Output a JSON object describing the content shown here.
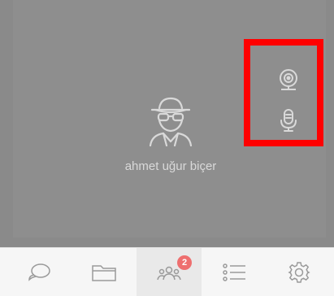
{
  "participant": {
    "name": "ahmet uğur biçer",
    "avatar_icon": "incognito-user-icon"
  },
  "media_controls": {
    "camera_icon": "webcam-icon",
    "mic_icon": "microphone-icon",
    "highlight_color": "#ff0000"
  },
  "toolbar": {
    "items": [
      {
        "icon": "chat-icon"
      },
      {
        "icon": "folder-icon"
      },
      {
        "icon": "participants-icon",
        "badge": "2",
        "active": true
      },
      {
        "icon": "list-icon"
      },
      {
        "icon": "settings-gear-icon"
      }
    ]
  },
  "colors": {
    "video_background": "#8e8e8e",
    "toolbar_background": "#f6f6f6",
    "badge": "#ee6f6f"
  }
}
